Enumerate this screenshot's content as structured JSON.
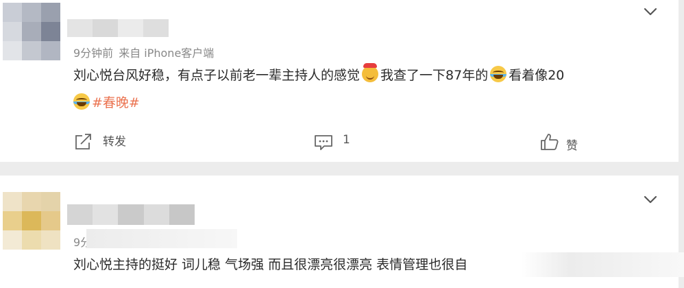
{
  "comments": [
    {
      "time": "9分钟前",
      "source": "来自 iPhone客户端",
      "text_part1": "刘心悦台风好稳，有点子以前老一辈主持人的感觉",
      "emoji1": "cat-face-emoji",
      "text_part2": "我查了一下87年的",
      "emoji2": "laughing-tears-emoji",
      "text_part3": "看着像20",
      "emoji3": "laughing-tears-emoji",
      "topic": "#春晚#",
      "actions": {
        "repost_label": "转发",
        "comment_count": "1",
        "like_label": "赞"
      }
    },
    {
      "time": "9分",
      "text": "刘心悦主持的挺好 词儿稳 气场强 而且很漂亮很漂亮 表情管理也很自"
    }
  ],
  "colors": {
    "topic": "#eb7350",
    "meta": "#888888",
    "page_bg": "#ececec"
  },
  "icons": [
    "chevron-down-icon",
    "repost-icon",
    "comment-icon",
    "like-icon"
  ]
}
